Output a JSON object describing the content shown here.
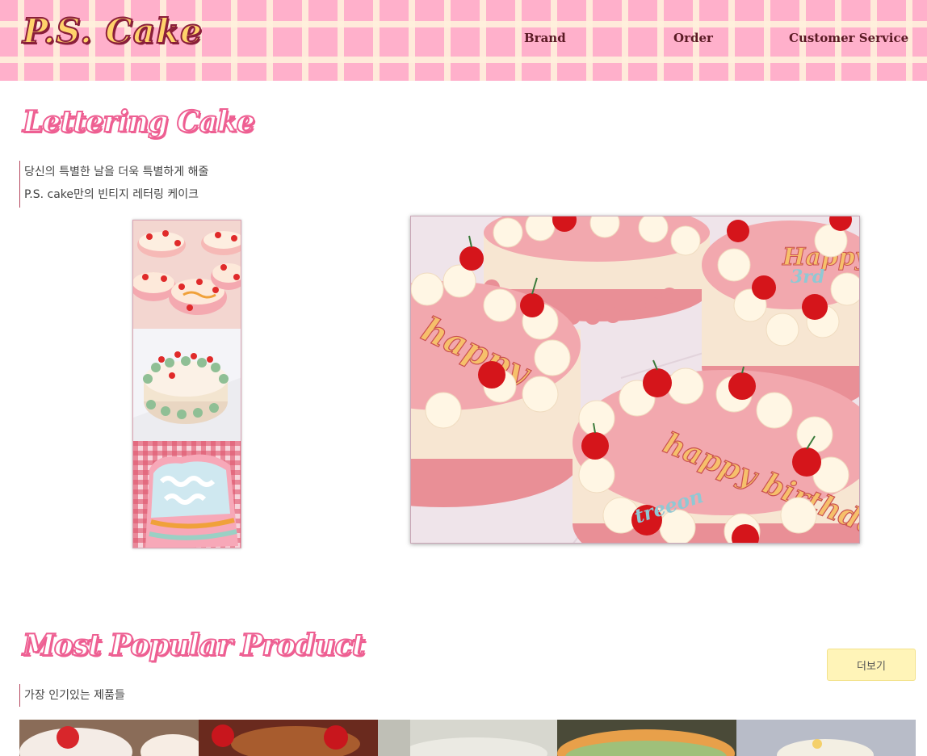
{
  "header": {
    "logo": "P.S. Cake",
    "nav": [
      {
        "label": "Brand"
      },
      {
        "label": "Order"
      },
      {
        "label": "Customer Service"
      }
    ]
  },
  "lettering": {
    "title": "Lettering Cake",
    "desc_line1": "당신의 특별한 날을 더욱 특별하게 해줄",
    "desc_line2": "P.S. cake만의 빈티지 레터링 케이크"
  },
  "gallery": {
    "main_cake_text": "happy birthday",
    "thumbnails": [
      {
        "icon": "cake-photo-icon"
      },
      {
        "icon": "cake-photo-icon"
      },
      {
        "icon": "cake-photo-icon"
      }
    ]
  },
  "popular": {
    "title": "Most Popular Product",
    "desc": "가장 인기있는 제품들",
    "more_label": "더보기"
  },
  "colors": {
    "accent_pink": "#ee5f92",
    "header_pink": "#ffb0cb",
    "more_button": "#fff4b8"
  }
}
